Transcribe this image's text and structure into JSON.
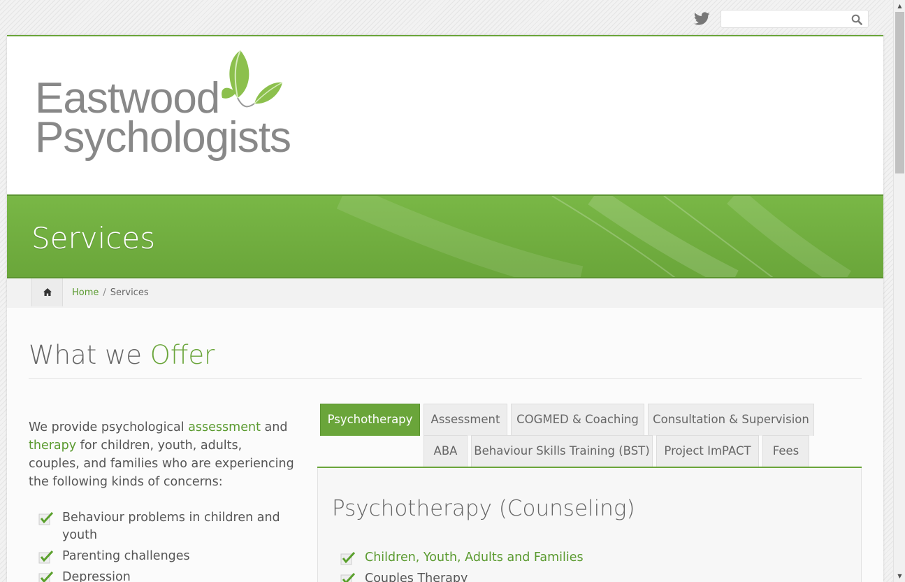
{
  "topbar": {
    "twitter_icon": "twitter-icon",
    "search_placeholder": "",
    "search_icon": "search-icon"
  },
  "logo": {
    "line1": "Eastwood",
    "line2": "Psychologists"
  },
  "banner": {
    "title": "Services"
  },
  "breadcrumbs": {
    "home_icon": "home-icon",
    "home_label": "Home",
    "separator": "/",
    "current": "Services"
  },
  "section": {
    "title_plain": "What we ",
    "title_accent": "Offer"
  },
  "intro": {
    "part1": "We provide psychological ",
    "link1": "assessment",
    "part2": " and ",
    "link2": "therapy",
    "part3": " for children, youth, adults, couples, and families who are experiencing the following kinds of concerns:"
  },
  "concerns": [
    "Behaviour problems in children and youth",
    "Parenting challenges",
    "Depression"
  ],
  "tabs": [
    "Psychotherapy",
    "Assessment",
    "COGMED & Coaching",
    "Consultation & Supervision",
    "ABA",
    "Behaviour Skills Training (BST)",
    "Project ImPACT",
    "Fees"
  ],
  "active_tab": "Psychotherapy",
  "panel": {
    "title": "Psychotherapy (Counseling)",
    "items": [
      "Children, Youth, Adults and Families",
      "Couples Therapy"
    ]
  },
  "colors": {
    "accent": "#6aa53a",
    "link": "#5a9a2f",
    "text": "#555555"
  }
}
